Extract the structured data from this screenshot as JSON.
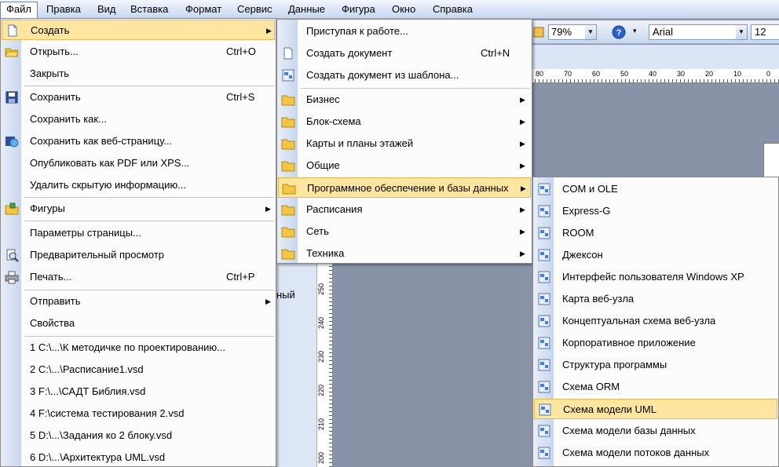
{
  "menubar": {
    "items": [
      "Файл",
      "Правка",
      "Вид",
      "Вставка",
      "Формат",
      "Сервис",
      "Данные",
      "Фигура",
      "Окно",
      "Справка"
    ]
  },
  "toolbar": {
    "zoom": "79%",
    "font": "Arial",
    "font_size": "12"
  },
  "ruler": {
    "h_labels": [
      "80",
      "70",
      "60",
      "50",
      "40",
      "30",
      "20",
      "10",
      "0"
    ],
    "v_labels": [
      "250",
      "240",
      "230",
      "220",
      "210",
      "200"
    ]
  },
  "background_text": "ный",
  "file_menu": {
    "items": [
      {
        "label": "Создать",
        "shortcut": "",
        "icon": "new-document-icon",
        "submenu": true,
        "highlighted": true
      },
      {
        "label": "Открыть...",
        "shortcut": "Ctrl+O",
        "icon": "open-folder-icon"
      },
      {
        "label": "Закрыть",
        "shortcut": ""
      },
      {
        "label": "Сохранить",
        "shortcut": "Ctrl+S",
        "icon": "save-disk-icon"
      },
      {
        "label": "Сохранить как...",
        "shortcut": ""
      },
      {
        "label": "Сохранить как веб-страницу...",
        "shortcut": "",
        "icon": "save-web-icon"
      },
      {
        "label": "Опубликовать как PDF или XPS...",
        "shortcut": ""
      },
      {
        "label": "Удалить скрытую информацию...",
        "shortcut": ""
      },
      {
        "label": "Фигуры",
        "shortcut": "",
        "icon": "shapes-folder-icon",
        "submenu": true
      },
      {
        "label": "Параметры страницы...",
        "shortcut": ""
      },
      {
        "label": "Предварительный просмотр",
        "shortcut": "",
        "icon": "print-preview-icon"
      },
      {
        "label": "Печать...",
        "shortcut": "Ctrl+P",
        "icon": "printer-icon"
      },
      {
        "label": "Отправить",
        "shortcut": "",
        "submenu": true
      },
      {
        "label": "Свойства",
        "shortcut": ""
      },
      {
        "label": "1 C:\\...\\К методичке по проектированию...",
        "shortcut": ""
      },
      {
        "label": "2 C:\\...\\Расписание1.vsd",
        "shortcut": ""
      },
      {
        "label": "3 F:\\...\\САДТ Библия.vsd",
        "shortcut": ""
      },
      {
        "label": "4 F:\\система тестирования 2.vsd",
        "shortcut": ""
      },
      {
        "label": "5 D:\\...\\Задания ко 2 блоку.vsd",
        "shortcut": ""
      },
      {
        "label": "6 D:\\...\\Архитектура UML.vsd",
        "shortcut": ""
      }
    ]
  },
  "create_menu": {
    "items": [
      {
        "label": "Приступая к работе...",
        "shortcut": ""
      },
      {
        "label": "Создать документ",
        "shortcut": "Ctrl+N",
        "icon": "blank-document-icon"
      },
      {
        "label": "Создать документ из шаблона...",
        "shortcut": "",
        "icon": "template-icon"
      },
      {
        "label": "Бизнес",
        "icon": "folder-icon",
        "submenu": true
      },
      {
        "label": "Блок-схема",
        "icon": "folder-icon",
        "submenu": true
      },
      {
        "label": "Карты и планы этажей",
        "icon": "folder-icon",
        "submenu": true
      },
      {
        "label": "Общие",
        "icon": "folder-icon",
        "submenu": true
      },
      {
        "label": "Программное обеспечение и базы данных",
        "icon": "folder-icon",
        "submenu": true,
        "highlighted": true
      },
      {
        "label": "Расписания",
        "icon": "folder-icon",
        "submenu": true
      },
      {
        "label": "Сеть",
        "icon": "folder-icon",
        "submenu": true
      },
      {
        "label": "Техника",
        "icon": "folder-icon",
        "submenu": true
      }
    ]
  },
  "software_menu": {
    "items": [
      {
        "label": "COM и OLE"
      },
      {
        "label": "Express-G"
      },
      {
        "label": "ROOM"
      },
      {
        "label": "Джексон"
      },
      {
        "label": "Интерфейс пользователя Windows XP"
      },
      {
        "label": "Карта веб-узла"
      },
      {
        "label": "Концептуальная схема веб-узла"
      },
      {
        "label": "Корпоративное приложение"
      },
      {
        "label": "Структура программы"
      },
      {
        "label": "Схема ORM"
      },
      {
        "label": "Схема модели UML",
        "highlighted": true
      },
      {
        "label": "Схема модели базы данных"
      },
      {
        "label": "Схема модели потоков данных"
      }
    ],
    "icon": "stencil-template-icon"
  }
}
